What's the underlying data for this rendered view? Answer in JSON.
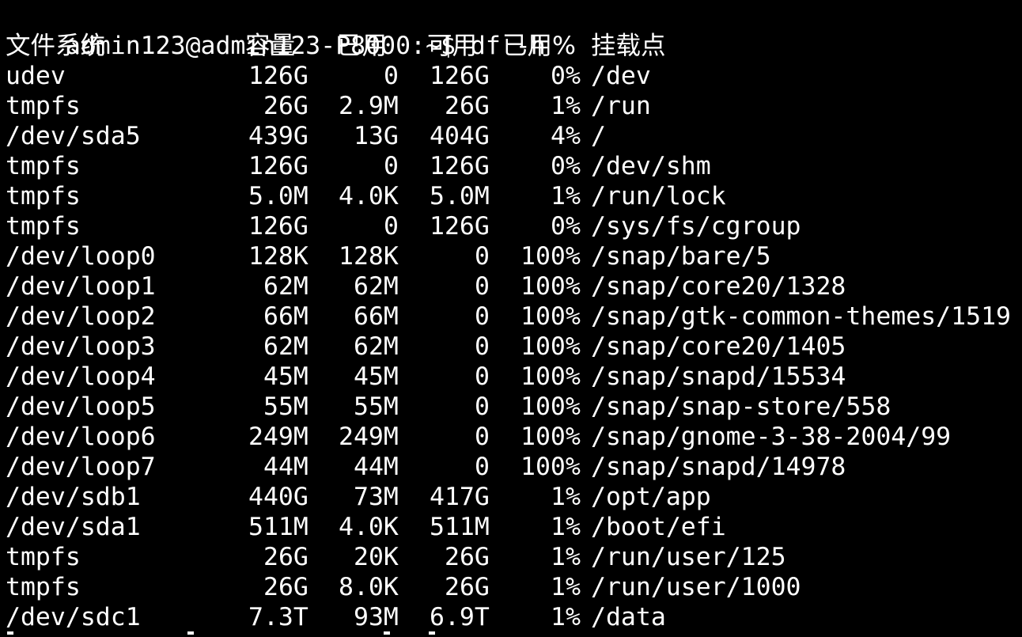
{
  "terminal": {
    "prompt": "admin123@admin123-P8000:~$ ",
    "command": "df -h",
    "headers": {
      "filesystem": "文件系统",
      "size": "容量",
      "used": "已用",
      "avail": "可用",
      "use_pct": "已用%",
      "mounted_on": "挂载点"
    },
    "rows": [
      {
        "fs": "udev",
        "size": "126G",
        "used": "0",
        "avail": "126G",
        "pct": "0%",
        "mount": "/dev"
      },
      {
        "fs": "tmpfs",
        "size": "26G",
        "used": "2.9M",
        "avail": "26G",
        "pct": "1%",
        "mount": "/run"
      },
      {
        "fs": "/dev/sda5",
        "size": "439G",
        "used": "13G",
        "avail": "404G",
        "pct": "4%",
        "mount": "/"
      },
      {
        "fs": "tmpfs",
        "size": "126G",
        "used": "0",
        "avail": "126G",
        "pct": "0%",
        "mount": "/dev/shm"
      },
      {
        "fs": "tmpfs",
        "size": "5.0M",
        "used": "4.0K",
        "avail": "5.0M",
        "pct": "1%",
        "mount": "/run/lock"
      },
      {
        "fs": "tmpfs",
        "size": "126G",
        "used": "0",
        "avail": "126G",
        "pct": "0%",
        "mount": "/sys/fs/cgroup"
      },
      {
        "fs": "/dev/loop0",
        "size": "128K",
        "used": "128K",
        "avail": "0",
        "pct": "100%",
        "mount": "/snap/bare/5"
      },
      {
        "fs": "/dev/loop1",
        "size": "62M",
        "used": "62M",
        "avail": "0",
        "pct": "100%",
        "mount": "/snap/core20/1328"
      },
      {
        "fs": "/dev/loop2",
        "size": "66M",
        "used": "66M",
        "avail": "0",
        "pct": "100%",
        "mount": "/snap/gtk-common-themes/1519"
      },
      {
        "fs": "/dev/loop3",
        "size": "62M",
        "used": "62M",
        "avail": "0",
        "pct": "100%",
        "mount": "/snap/core20/1405"
      },
      {
        "fs": "/dev/loop4",
        "size": "45M",
        "used": "45M",
        "avail": "0",
        "pct": "100%",
        "mount": "/snap/snapd/15534"
      },
      {
        "fs": "/dev/loop5",
        "size": "55M",
        "used": "55M",
        "avail": "0",
        "pct": "100%",
        "mount": "/snap/snap-store/558"
      },
      {
        "fs": "/dev/loop6",
        "size": "249M",
        "used": "249M",
        "avail": "0",
        "pct": "100%",
        "mount": "/snap/gnome-3-38-2004/99"
      },
      {
        "fs": "/dev/loop7",
        "size": "44M",
        "used": "44M",
        "avail": "0",
        "pct": "100%",
        "mount": "/snap/snapd/14978"
      },
      {
        "fs": "/dev/sdb1",
        "size": "440G",
        "used": "73M",
        "avail": "417G",
        "pct": "1%",
        "mount": "/opt/app"
      },
      {
        "fs": "/dev/sda1",
        "size": "511M",
        "used": "4.0K",
        "avail": "511M",
        "pct": "1%",
        "mount": "/boot/efi"
      },
      {
        "fs": "tmpfs",
        "size": "26G",
        "used": "20K",
        "avail": "26G",
        "pct": "1%",
        "mount": "/run/user/125"
      },
      {
        "fs": "tmpfs",
        "size": "26G",
        "used": "8.0K",
        "avail": "26G",
        "pct": "1%",
        "mount": "/run/user/1000"
      },
      {
        "fs": "/dev/sdc1",
        "size": "7.3T",
        "used": "93M",
        "avail": "6.9T",
        "pct": "1%",
        "mount": "/data"
      }
    ],
    "colors": {
      "background": "#000000",
      "foreground": "#ffffff"
    }
  }
}
